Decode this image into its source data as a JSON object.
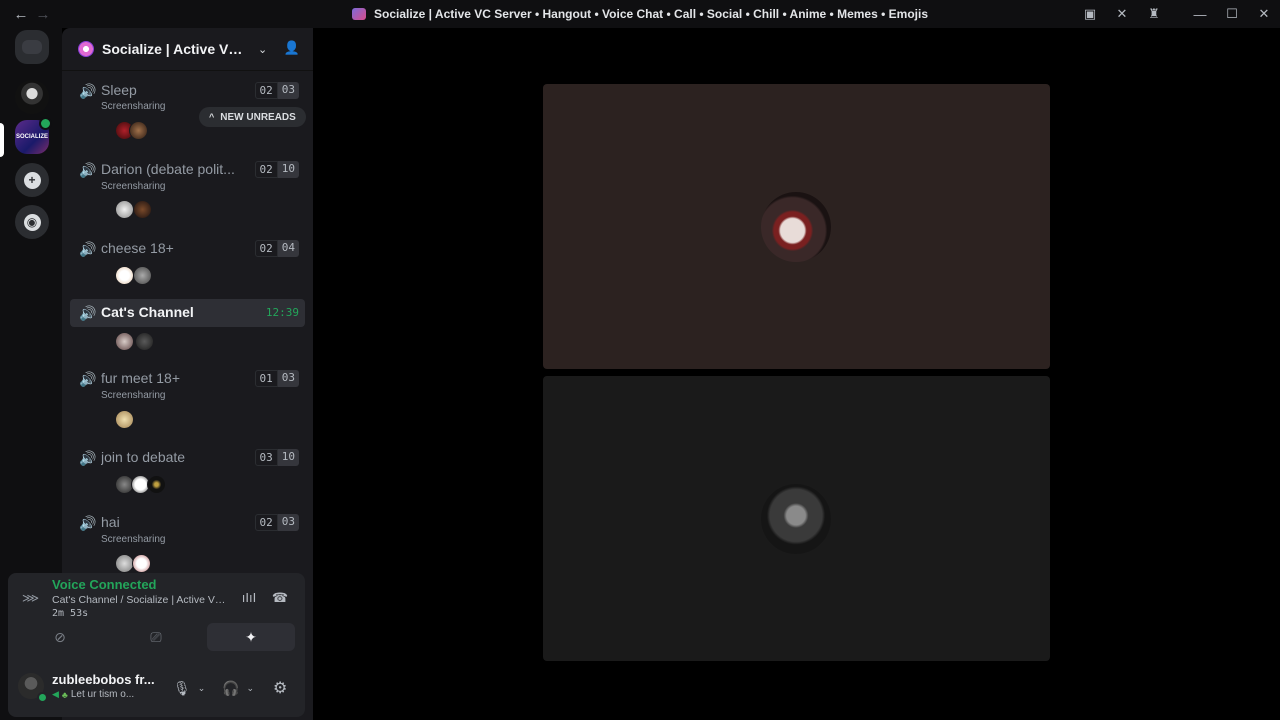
{
  "window": {
    "title": "Socialize | Active VC Server • Hangout • Voice Chat • Call • Social • Chill • Anime • Memes • Emojis",
    "back_icon": "←",
    "forward_icon": "→",
    "tb_inbox_icon": "▣",
    "tb_tools_icon": "✕",
    "tb_help_icon": "♜",
    "minimize": "—",
    "maximize": "☐",
    "close": "✕"
  },
  "rail": {
    "server2_label": "SOCIALIZE",
    "add_glyph": "+",
    "discover_glyph": "◉"
  },
  "server": {
    "name": "Socialize | Active VC S...",
    "chevron": "⌄",
    "invite_glyph": "👤"
  },
  "new_unreads": {
    "caret": "^",
    "label": "NEW UNREADS"
  },
  "channels": [
    {
      "name": "Sleep",
      "sub": "Screensharing",
      "count_a": "02",
      "count_b": "03"
    },
    {
      "name": "Darion (debate polit...",
      "sub": "Screensharing",
      "count_a": "02",
      "count_b": "10"
    },
    {
      "name": "cheese 18+",
      "count_a": "02",
      "count_b": "04"
    },
    {
      "name": "Cat's Channel",
      "time": "12:39",
      "active": true
    },
    {
      "name": "fur meet 18+",
      "sub": "Screensharing",
      "count_a": "01",
      "count_b": "03"
    },
    {
      "name": "join to debate",
      "count_a": "03",
      "count_b": "10"
    },
    {
      "name": "hai",
      "sub": "Screensharing",
      "count_a": "02",
      "count_b": "03"
    }
  ],
  "speaker_glyph": "🔊",
  "voice_panel": {
    "status": "Voice Connected",
    "location": "Cat's Channel / Socialize | Active VC...",
    "timer": "2m 53s",
    "signal_glyph": "⋙",
    "noise_glyph": "ıIıI",
    "disconnect_glyph": "☎",
    "camera_glyph": "⊘",
    "screen_glyph": "⎚",
    "activity_glyph": "✦"
  },
  "user_panel": {
    "name": "zubleebobos fr...",
    "speaker": "◀",
    "plant": "♣",
    "status_text": "Let ur tism o...",
    "mic_glyph": "🎙",
    "headset_glyph": "🎧",
    "chevron": "⌄",
    "settings_glyph": "⚙"
  },
  "colors": {
    "accent_green": "#23a55a",
    "sidebar_bg": "#1a1a1e",
    "tile1_bg": "#2c2220",
    "tile2_bg": "#1a1a1a"
  }
}
